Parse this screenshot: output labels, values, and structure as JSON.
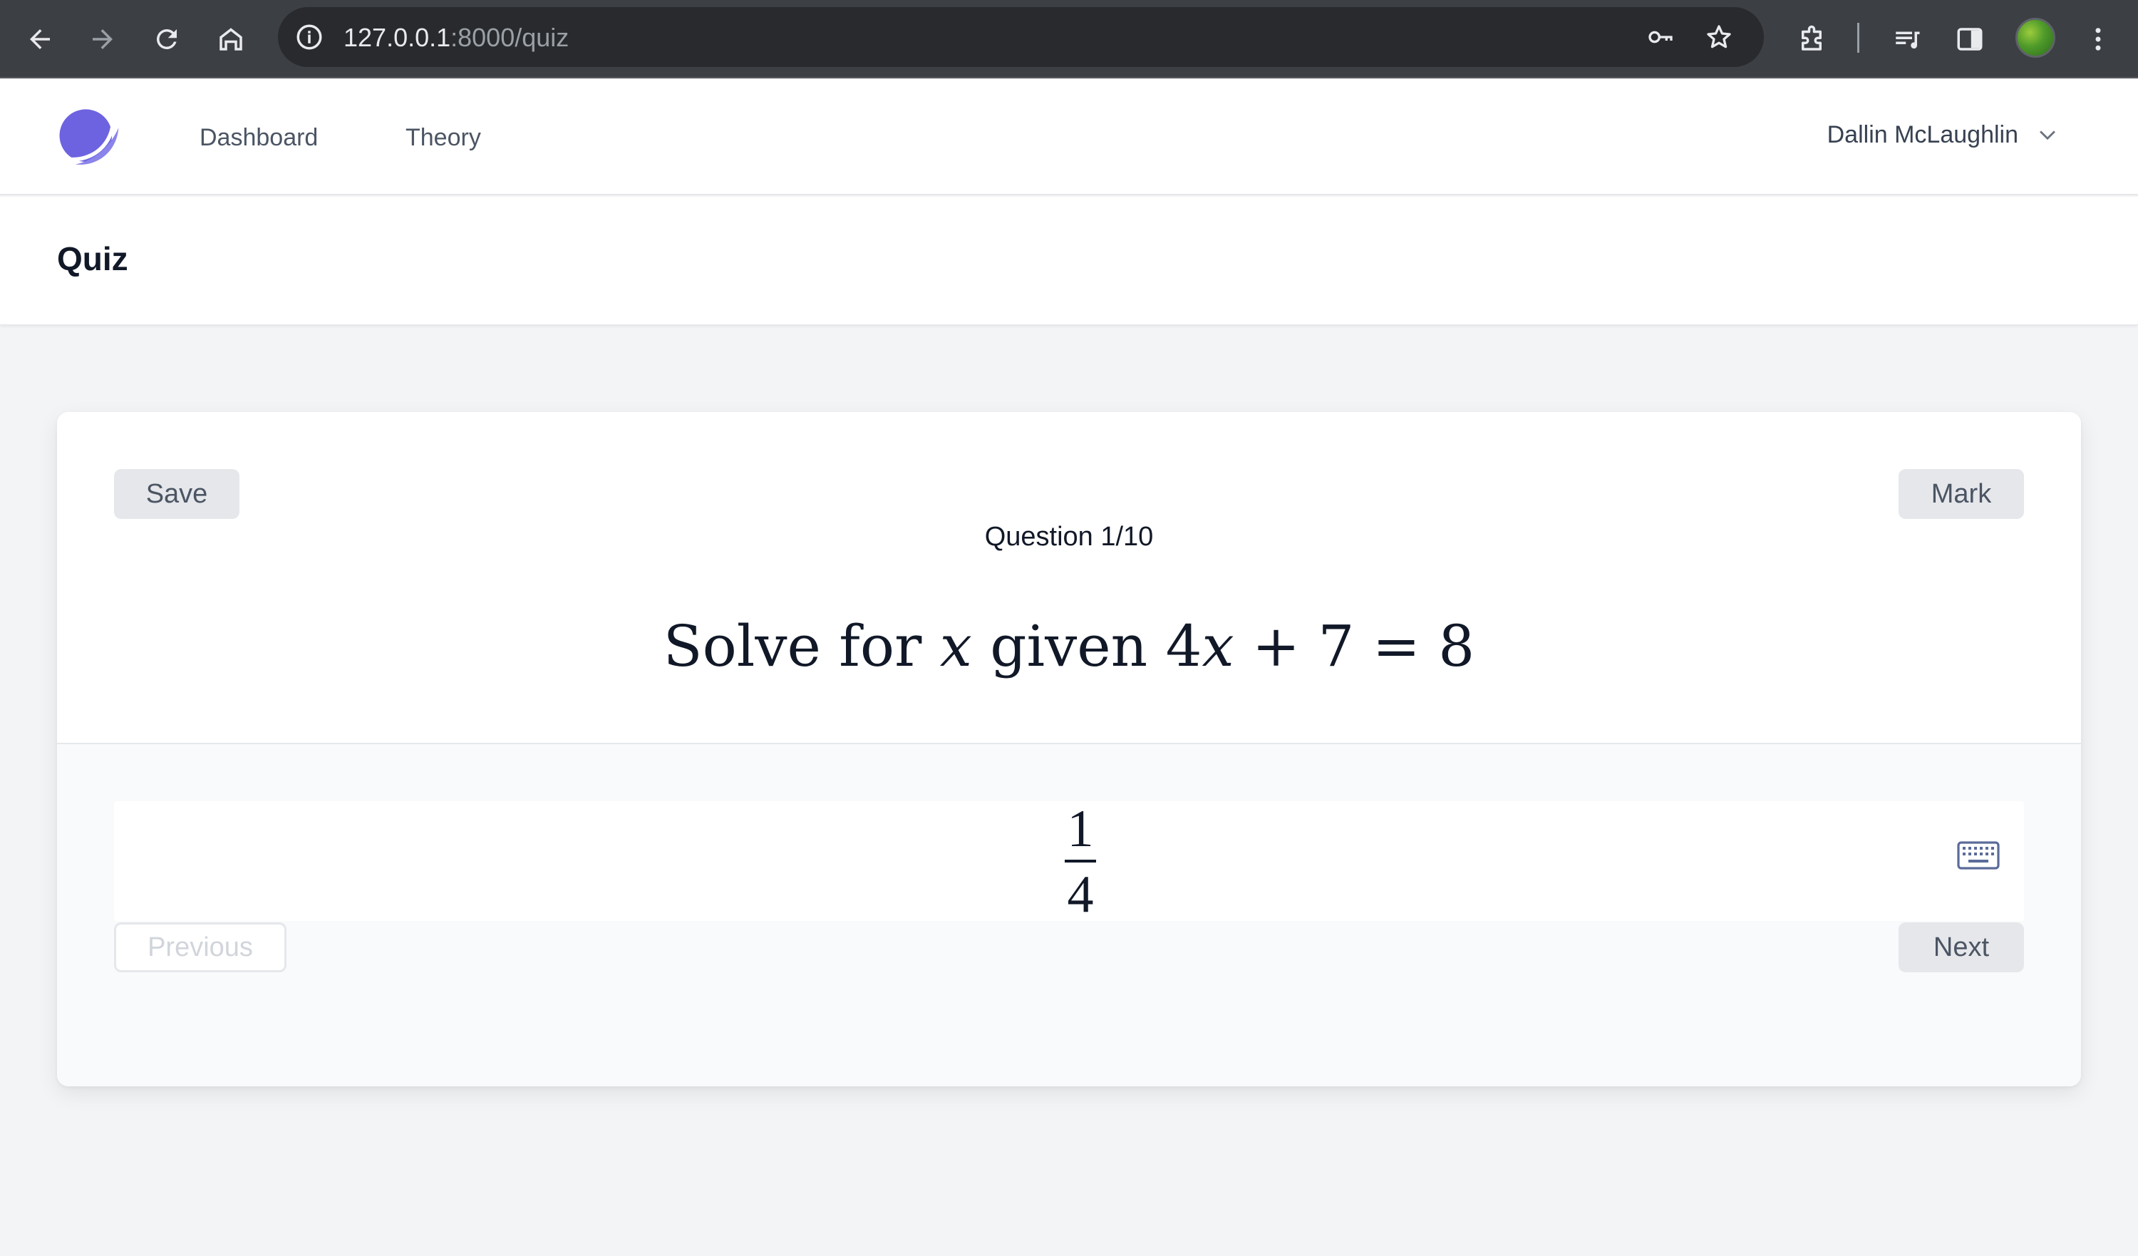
{
  "browser": {
    "url_host": "127.0.0.1",
    "url_path": ":8000/quiz",
    "icons": [
      "back-arrow-icon",
      "forward-arrow-icon",
      "reload-icon",
      "home-icon",
      "site-info-icon",
      "key-icon",
      "star-icon",
      "extensions-icon",
      "media-icon",
      "side-panel-icon",
      "profile-avatar",
      "more-vert-icon"
    ]
  },
  "nav": {
    "dashboard_label": "Dashboard",
    "theory_label": "Theory",
    "user_name": "Dallin McLaughlin"
  },
  "page": {
    "title": "Quiz"
  },
  "quiz": {
    "save_label": "Save",
    "mark_label": "Mark",
    "counter": "Question 1/10",
    "question": {
      "prefix": "Solve for ",
      "var": "x",
      "given": " given 4",
      "var2": "x",
      "equation_rest": " + 7 = 8"
    },
    "answer": {
      "numerator": "1",
      "denominator": "4"
    },
    "previous_label": "Previous",
    "next_label": "Next"
  },
  "colors": {
    "brand": "#6d63e0",
    "background": "#f3f4f6",
    "button_gray": "#e5e7eb"
  }
}
